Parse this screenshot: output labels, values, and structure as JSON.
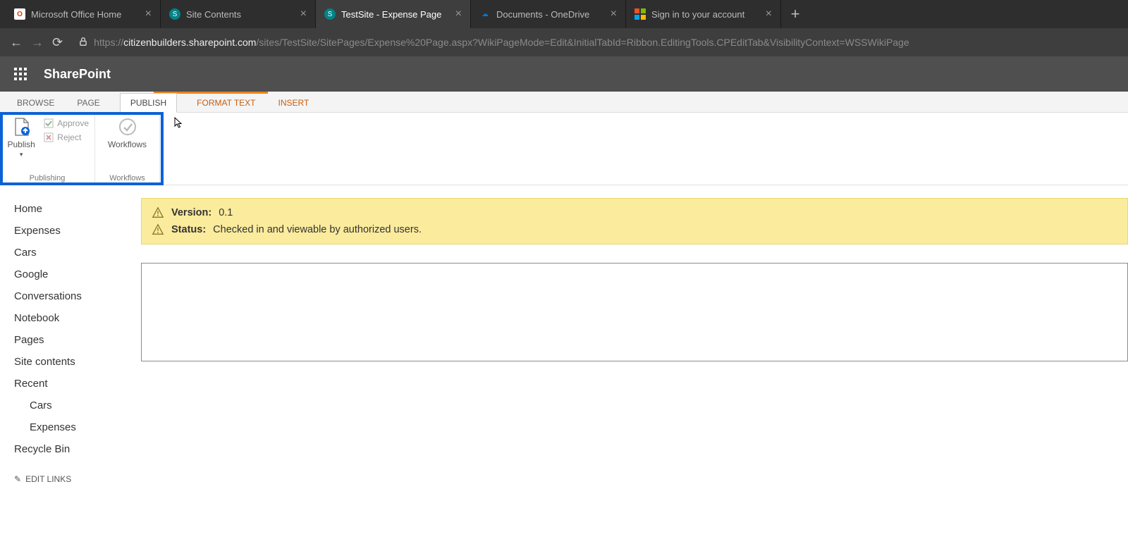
{
  "browser": {
    "tabs": [
      {
        "title": "Microsoft Office Home"
      },
      {
        "title": "Site Contents"
      },
      {
        "title": "TestSite - Expense Page"
      },
      {
        "title": "Documents - OneDrive"
      },
      {
        "title": "Sign in to your account"
      }
    ],
    "url_prefix": "https://",
    "url_host": "citizenbuilders.sharepoint.com",
    "url_path": "/sites/TestSite/SitePages/Expense%20Page.aspx?WikiPageMode=Edit&InitialTabId=Ribbon.EditingTools.CPEditTab&VisibilityContext=WSSWikiPage"
  },
  "suite": {
    "title": "SharePoint"
  },
  "ribbon": {
    "tabs": {
      "browse": "BROWSE",
      "page": "PAGE",
      "publish": "PUBLISH",
      "format_text": "FORMAT TEXT",
      "insert": "INSERT"
    },
    "publish_btn": "Publish",
    "approve": "Approve",
    "reject": "Reject",
    "workflows_btn": "Workflows",
    "group_publishing": "Publishing",
    "group_workflows": "Workflows"
  },
  "leftnav": {
    "items": [
      "Home",
      "Expenses",
      "Cars",
      "Google",
      "Conversations",
      "Notebook",
      "Pages",
      "Site contents",
      "Recent"
    ],
    "recent_sub": [
      "Cars",
      "Expenses"
    ],
    "recycle": "Recycle Bin",
    "edit_links": "EDIT LINKS"
  },
  "status": {
    "version_label": "Version:",
    "version_value": "0.1",
    "status_label": "Status:",
    "status_value": "Checked in and viewable by authorized users."
  }
}
